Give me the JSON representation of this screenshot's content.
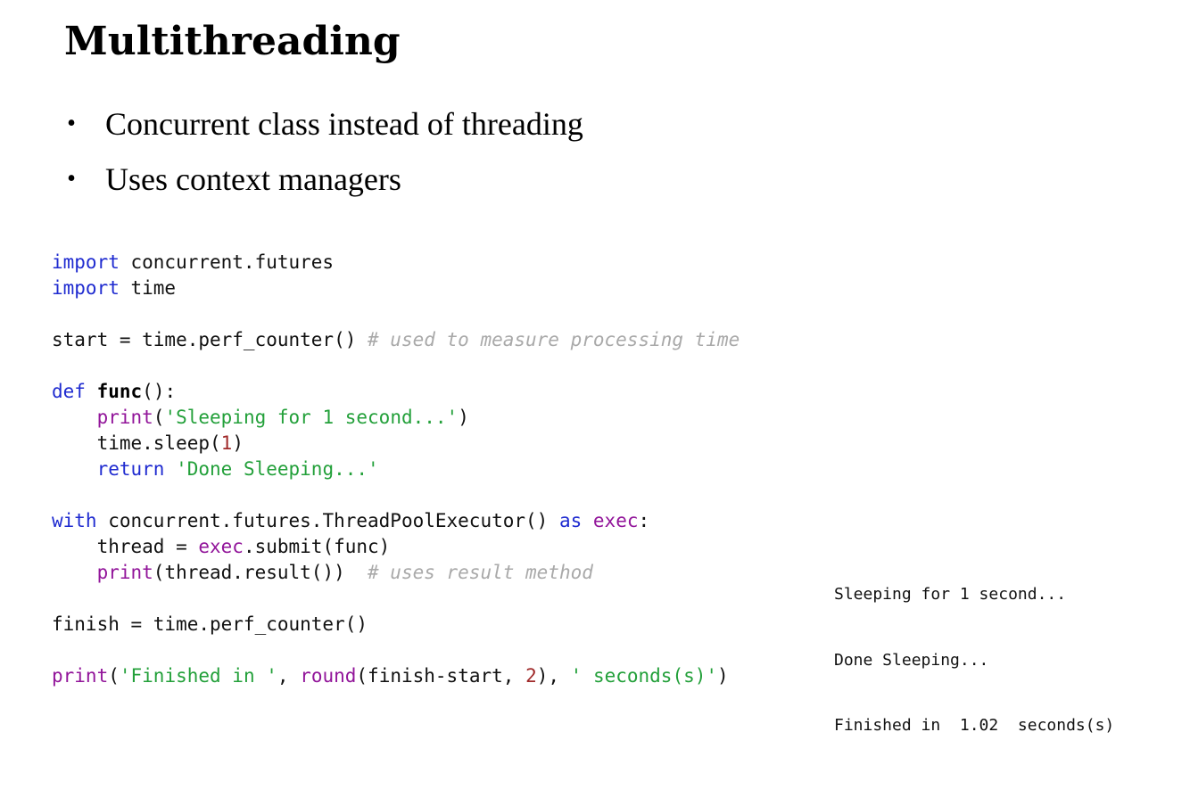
{
  "slide": {
    "title": "Multithreading",
    "bullets": [
      {
        "marker": "•",
        "text": "Concurrent class instead of threading"
      },
      {
        "marker": "•",
        "text": "Uses context managers"
      }
    ]
  },
  "code": {
    "lines": [
      [
        {
          "t": "import",
          "c": "kw"
        },
        {
          "t": " concurrent.futures",
          "c": "pl"
        }
      ],
      [
        {
          "t": "import",
          "c": "kw"
        },
        {
          "t": " time",
          "c": "pl"
        }
      ],
      [],
      [
        {
          "t": "start = time.perf_counter() ",
          "c": "pl"
        },
        {
          "t": "# used to measure processing time",
          "c": "cm"
        }
      ],
      [],
      [
        {
          "t": "def",
          "c": "kw"
        },
        {
          "t": " ",
          "c": "pl"
        },
        {
          "t": "func",
          "c": "fn"
        },
        {
          "t": "():",
          "c": "pl"
        }
      ],
      [
        {
          "t": "    ",
          "c": "pl"
        },
        {
          "t": "print",
          "c": "bi"
        },
        {
          "t": "(",
          "c": "pl"
        },
        {
          "t": "'Sleeping for 1 second...'",
          "c": "st"
        },
        {
          "t": ")",
          "c": "pl"
        }
      ],
      [
        {
          "t": "    time.sleep(",
          "c": "pl"
        },
        {
          "t": "1",
          "c": "nm"
        },
        {
          "t": ")",
          "c": "pl"
        }
      ],
      [
        {
          "t": "    ",
          "c": "pl"
        },
        {
          "t": "return",
          "c": "kw"
        },
        {
          "t": " ",
          "c": "pl"
        },
        {
          "t": "'Done Sleeping...'",
          "c": "st"
        }
      ],
      [],
      [
        {
          "t": "with",
          "c": "kw"
        },
        {
          "t": " concurrent.futures.ThreadPoolExecutor() ",
          "c": "pl"
        },
        {
          "t": "as",
          "c": "kw"
        },
        {
          "t": " ",
          "c": "pl"
        },
        {
          "t": "exec",
          "c": "bi"
        },
        {
          "t": ":",
          "c": "pl"
        }
      ],
      [
        {
          "t": "    thread = ",
          "c": "pl"
        },
        {
          "t": "exec",
          "c": "bi"
        },
        {
          "t": ".submit(func)",
          "c": "pl"
        }
      ],
      [
        {
          "t": "    ",
          "c": "pl"
        },
        {
          "t": "print",
          "c": "bi"
        },
        {
          "t": "(thread.result())  ",
          "c": "pl"
        },
        {
          "t": "# uses result method",
          "c": "cm"
        }
      ],
      [],
      [
        {
          "t": "finish = time.perf_counter()",
          "c": "pl"
        }
      ],
      [],
      [
        {
          "t": "print",
          "c": "bi"
        },
        {
          "t": "(",
          "c": "pl"
        },
        {
          "t": "'Finished in '",
          "c": "st"
        },
        {
          "t": ", ",
          "c": "pl"
        },
        {
          "t": "round",
          "c": "bi"
        },
        {
          "t": "(finish-start, ",
          "c": "pl"
        },
        {
          "t": "2",
          "c": "nm"
        },
        {
          "t": "), ",
          "c": "pl"
        },
        {
          "t": "' seconds(s)'",
          "c": "st"
        },
        {
          "t": ")",
          "c": "pl"
        }
      ]
    ]
  },
  "output": {
    "lines": [
      "Sleeping for 1 second...",
      "Done Sleeping...",
      "Finished in  1.02  seconds(s)"
    ]
  },
  "colors": {
    "keyword": "#1f2bd0",
    "builtin": "#92159a",
    "string": "#23a03a",
    "number": "#a02a2a",
    "comment": "#a9a9a9"
  }
}
